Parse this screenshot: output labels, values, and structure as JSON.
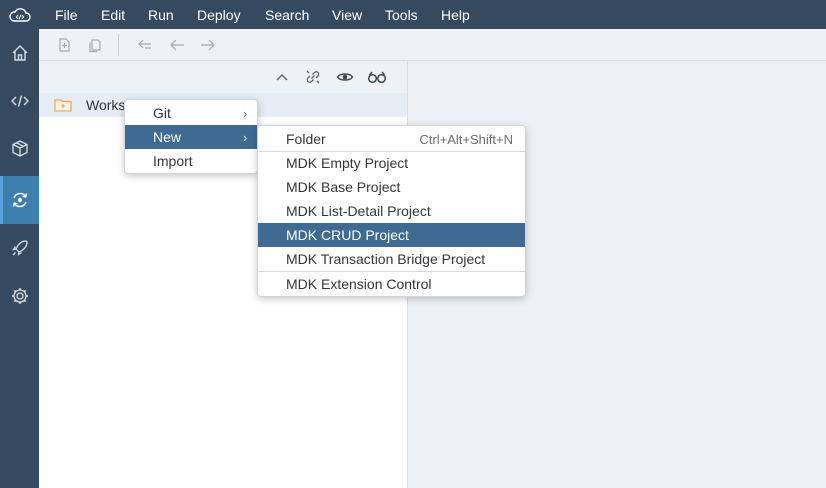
{
  "menubar": {
    "items": [
      "File",
      "Edit",
      "Run",
      "Deploy",
      "Search",
      "View",
      "Tools",
      "Help"
    ]
  },
  "activity_bar": {
    "items": [
      "home-icon",
      "code-icon",
      "package-icon",
      "sync-icon",
      "rocket-icon",
      "settings-icon"
    ],
    "active": "sync-icon"
  },
  "explorer": {
    "workspace_label": "Works"
  },
  "context_menu": {
    "items": [
      {
        "label": "Git",
        "arrow": "›"
      },
      {
        "label": "New",
        "arrow": "›"
      },
      {
        "label": "Import"
      }
    ],
    "highlighted": "New"
  },
  "submenu": {
    "items": [
      {
        "label": "Folder",
        "shortcut": "Ctrl+Alt+Shift+N"
      },
      {
        "label": "MDK Empty Project"
      },
      {
        "label": "MDK Base Project"
      },
      {
        "label": "MDK List-Detail Project"
      },
      {
        "label": "MDK CRUD Project"
      },
      {
        "label": "MDK Transaction Bridge Project"
      },
      {
        "label": "MDK Extension Control"
      }
    ],
    "highlighted": "MDK CRUD Project"
  },
  "colors": {
    "shell": "#354a5f",
    "active_activity": "#3f7fb0",
    "menu_highlight": "#3f6a92",
    "folder_icon": "#e9a23b"
  }
}
